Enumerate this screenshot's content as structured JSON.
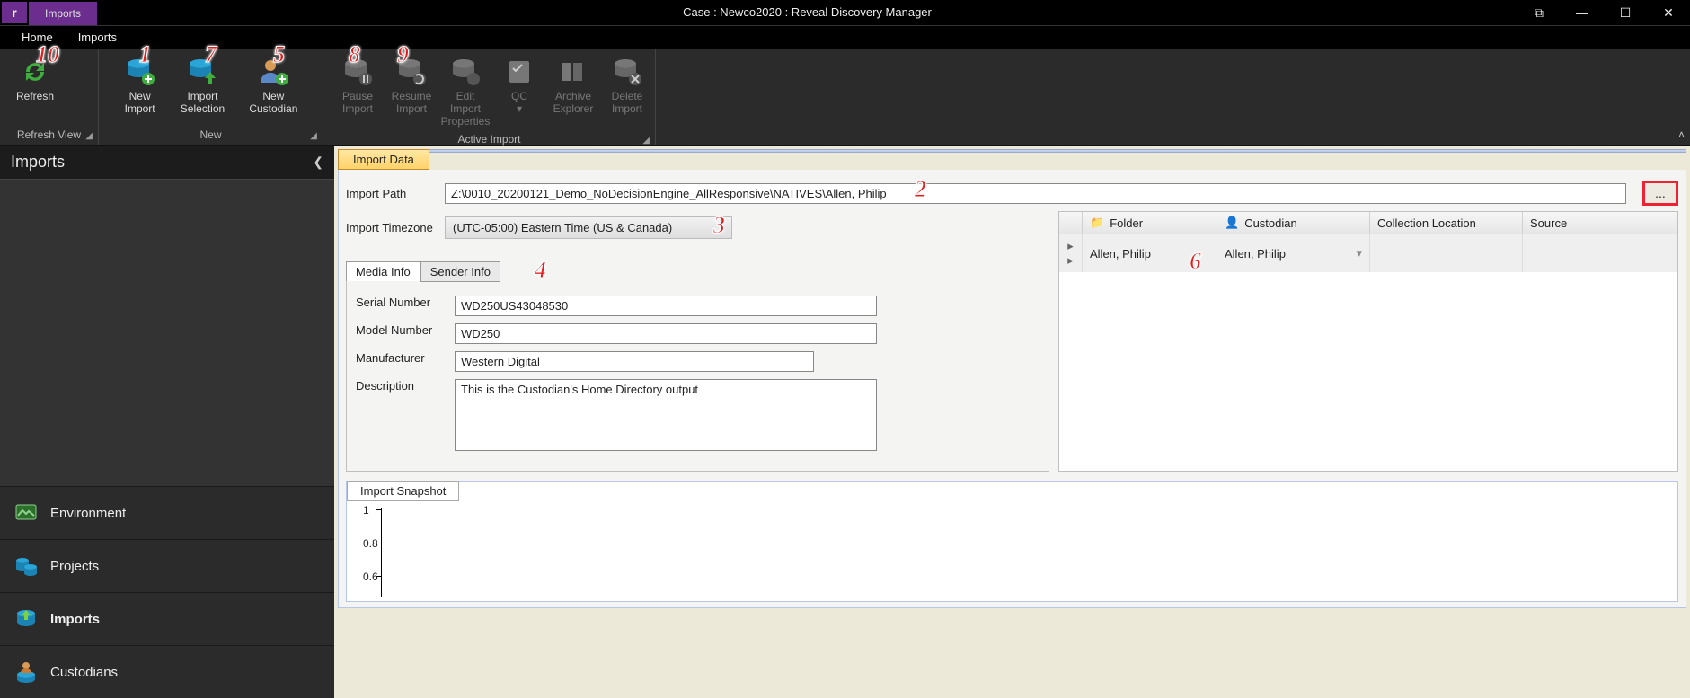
{
  "window": {
    "title": "Case : Newco2020 : Reveal Discovery Manager",
    "app_letter": "r",
    "title_tab": "Imports"
  },
  "menutabs": {
    "home": "Home",
    "imports": "Imports"
  },
  "ribbon": {
    "refresh": "Refresh",
    "refresh_group": "Refresh View",
    "new_import": "New Import",
    "import_selection_l1": "Import",
    "import_selection_l2": "Selection",
    "new_custodian": "New Custodian",
    "new_group": "New",
    "pause_l1": "Pause",
    "pause_l2": "Import",
    "resume_l1": "Resume",
    "resume_l2": "Import",
    "edit_l1": "Edit Import",
    "edit_l2": "Properties",
    "qc": "QC",
    "archive_l1": "Archive",
    "archive_l2": "Explorer",
    "delete_l1": "Delete",
    "delete_l2": "Import",
    "active_group": "Active Import"
  },
  "left": {
    "heading": "Imports",
    "nav_env": "Environment",
    "nav_projects": "Projects",
    "nav_imports": "Imports",
    "nav_custodians": "Custodians"
  },
  "main": {
    "tab": "Import Data",
    "path_label": "Import Path",
    "path_value": "Z:\\0010_20200121_Demo_NoDecisionEngine_AllResponsive\\NATIVES\\Allen, Philip",
    "browse": "...",
    "tz_label": "Import Timezone",
    "tz_value": "(UTC-05:00) Eastern Time (US & Canada)",
    "media_tab": "Media Info",
    "sender_tab": "Sender Info",
    "serial_label": "Serial Number",
    "serial_value": "WD250US43048530",
    "model_label": "Model Number",
    "model_value": "WD250",
    "manu_label": "Manufacturer",
    "manu_value": "Western Digital",
    "desc_label": "Description",
    "desc_value": "This is the Custodian's Home Directory output",
    "grid_h_folder": "Folder",
    "grid_h_cust": "Custodian",
    "grid_h_loc": "Collection Location",
    "grid_h_src": "Source",
    "grid_r_folder": "Allen, Philip",
    "grid_r_cust": "Allen, Philip",
    "snapshot_tab": "Import Snapshot"
  },
  "callouts": {
    "c1": "1",
    "c2": "2",
    "c3": "3",
    "c4": "4",
    "c5": "5",
    "c6": "6",
    "c7": "7",
    "c8": "8",
    "c9": "9",
    "c10": "10"
  },
  "chart_data": {
    "type": "line",
    "title": "Import Snapshot",
    "ylim": [
      0,
      1
    ],
    "yticks": [
      1,
      0.8,
      0.6
    ],
    "series": [],
    "xlabel": "",
    "ylabel": ""
  }
}
